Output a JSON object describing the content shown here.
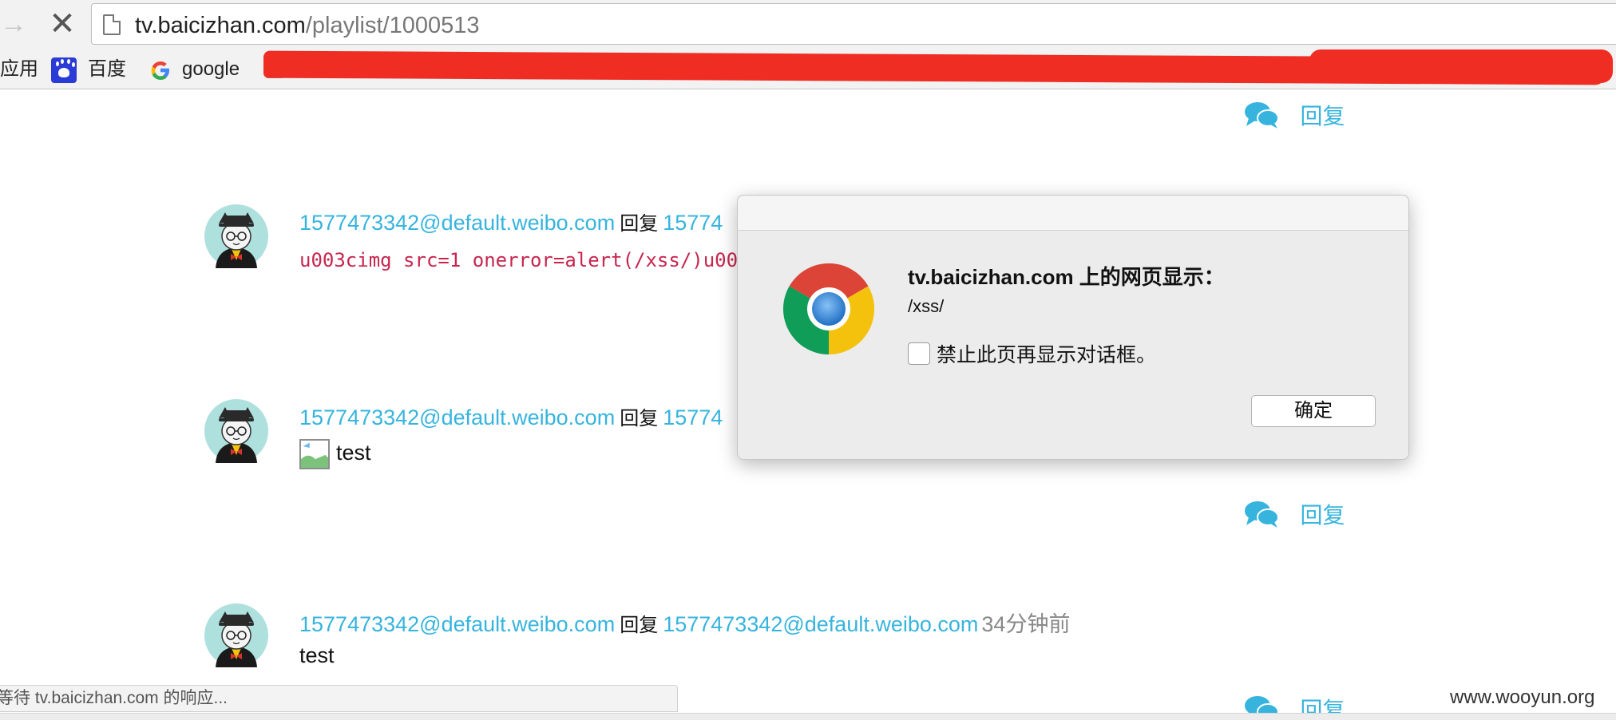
{
  "browser": {
    "forward_glyph": "→",
    "stop_glyph": "✕",
    "url_host": "tv.baicizhan.com",
    "url_path": "/playlist/1000513",
    "bookmarks": [
      {
        "label": "应用",
        "icon": "apps-icon"
      },
      {
        "label": "百度",
        "icon": "baidu-icon"
      },
      {
        "label": "google",
        "icon": "google-icon"
      }
    ]
  },
  "comments": [
    {
      "user": "1577473342@default.weibo.com",
      "reply_word": "回复",
      "target": "15774",
      "time": "",
      "body": "u003cimg src=1 onerror=alert(/xss/)u00",
      "body_type": "code"
    },
    {
      "user": "1577473342@default.weibo.com",
      "reply_word": "回复",
      "target": "15774",
      "time": "",
      "body": "test",
      "body_type": "image-text"
    },
    {
      "user": "1577473342@default.weibo.com",
      "reply_word": "回复",
      "target": "1577473342@default.weibo.com",
      "time": "34分钟前",
      "body": "test",
      "body_type": "text"
    }
  ],
  "reply_label": "回复",
  "status_text": "等待 tv.baicizhan.com 的响应...",
  "watermark": "www.wooyun.org",
  "dialog": {
    "title": "tv.baicizhan.com 上的网页显示：",
    "message": "/xss/",
    "suppress_label": "禁止此页再显示对话框。",
    "ok_label": "确定"
  },
  "colors": {
    "link": "#36b4de",
    "code": "#c7254e",
    "redaction": "#f02d23"
  }
}
